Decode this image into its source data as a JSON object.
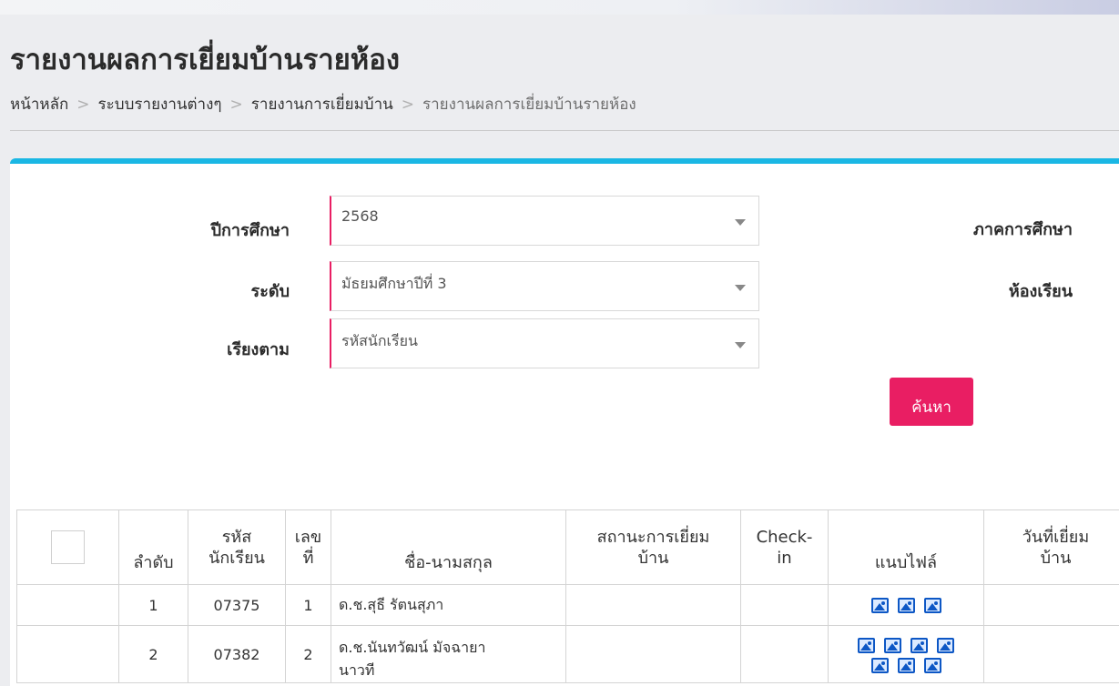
{
  "page": {
    "title": "รายงานผลการเยี่ยมบ้านรายห้อง"
  },
  "breadcrumb": [
    "หน้าหลัก",
    "ระบบรายงานต่างๆ",
    "รายงานการเยี่ยมบ้าน",
    "รายงานผลการเยี่ยมบ้านรายห้อง"
  ],
  "breadcrumb_separator": ">",
  "filters": {
    "year": {
      "label": "ปีการศึกษา",
      "value": "2568"
    },
    "level": {
      "label": "ระดับ",
      "value": "มัธยมศึกษาปีที่ 3"
    },
    "sort": {
      "label": "เรียงตาม",
      "value": "รหัสนักเรียน"
    },
    "semester": {
      "label": "ภาคการศึกษา"
    },
    "classroom": {
      "label": "ห้องเรียน"
    },
    "search_label": "ค้นหา"
  },
  "table": {
    "headers": {
      "order": "ลำดับ",
      "student_id": "รหัส\nนักเรียน",
      "number": "เลข\nที่",
      "name": "ชื่อ-นามสกุล",
      "visit_status": "สถานะการเยี่ยม\nบ้าน",
      "checkin": "Check-\nin",
      "attachments": "แนบไฟล์",
      "visit_date": "วันที่เยี่ยม\nบ้าน"
    },
    "rows": [
      {
        "order": "1",
        "student_id": "07375",
        "number": "1",
        "name": "ด.ช.สุธี รัตนสุภา",
        "name_cont": "",
        "attachments": 3
      },
      {
        "order": "2",
        "student_id": "07382",
        "number": "2",
        "name": "ด.ช.นันทวัฒน์ มัจฉายา",
        "name_cont": "นาวที",
        "attachments": 7
      }
    ]
  },
  "icons": {
    "image": "image-file-icon",
    "caret": "caret-down-icon"
  },
  "colors": {
    "accent": "#1ab7e4",
    "primary": "#e91e63",
    "icon": "#0d57c5"
  }
}
